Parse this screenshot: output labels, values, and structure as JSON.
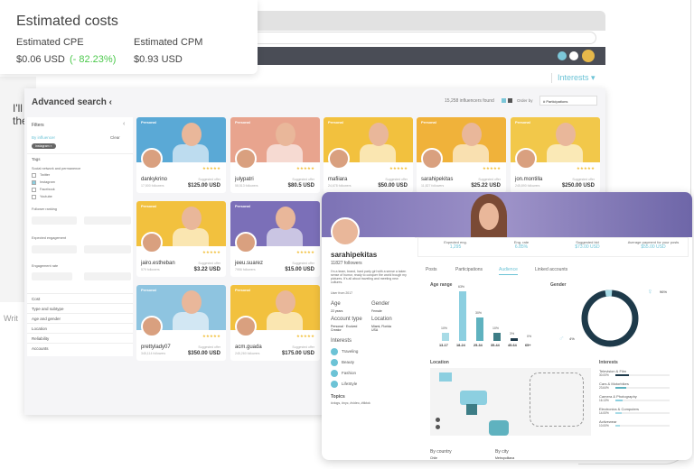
{
  "chat": {
    "lines": [
      "I'll",
      "the",
      "Writ"
    ]
  },
  "header": {
    "interests_label": "Interests ▾"
  },
  "estimated": {
    "title": "Estimated costs",
    "cpe_label": "Estimated CPE",
    "cpe_value": "$0.06 USD",
    "cpe_change": "(- 82.23%)",
    "cpm_label": "Estimated CPM",
    "cpm_value": "$0.93 USD",
    "change_color": "#4cc94c"
  },
  "search": {
    "title": "Advanced search ‹",
    "found": "15,258 influencers found",
    "order_label": "Order by",
    "order_value": "# Participations"
  },
  "filters": {
    "title": "Filters",
    "by_influencer": "By influencer",
    "clear": "Clear",
    "chip": "Instagram ×",
    "tags": "Tags",
    "social_label": "Social network and permanence",
    "networks": [
      {
        "label": "Twitter",
        "checked": false
      },
      {
        "label": "Instagram",
        "checked": true
      },
      {
        "label": "Facebook",
        "checked": false
      },
      {
        "label": "Youtube",
        "checked": false
      }
    ],
    "follower_ranking": "Follower ranking",
    "expected_engagement": "Expected engagement",
    "engagement_rate": "Engagement rate",
    "min": "Min",
    "max": "Max",
    "sections": [
      "Cost",
      "Type and subtype",
      "Age and gender",
      "Location",
      "Reliability",
      "Accounts"
    ]
  },
  "cards": [
    {
      "tag": "Personal",
      "name": "dankykrino",
      "followers": "17,500 followers",
      "offer_label": "Suggested offer",
      "price": "$125.00 USD",
      "color": "#5aa9d6"
    },
    {
      "tag": "Personal",
      "name": "julypatri",
      "followers": "58,513 followers",
      "offer_label": "Suggested offer",
      "price": "$80.5 USD",
      "color": "#e8a48e"
    },
    {
      "tag": "Personal",
      "name": "mafiiara",
      "followers": "24,678 followers",
      "offer_label": "Suggested offer",
      "price": "$50.00 USD",
      "color": "#f2c13e"
    },
    {
      "tag": "Personal",
      "name": "sarahipekitas",
      "followers": "11,827 followers",
      "offer_label": "Suggested offer",
      "price": "$25.22 USD",
      "color": "#f0b23a"
    },
    {
      "tag": "Personal",
      "name": "jon.montilla",
      "followers": "245,890 followers",
      "offer_label": "Suggested offer",
      "price": "$250.00 USD",
      "color": "#f2c84a"
    },
    {
      "tag": "Personal",
      "name": "jairo.estheban",
      "followers": "579 followers",
      "offer_label": "Suggested offer",
      "price": "$3.22 USD",
      "color": "#f2c13e"
    },
    {
      "tag": "Personal",
      "name": "jeeu.suarez",
      "followers": "7956 followers",
      "offer_label": "Suggested offer",
      "price": "$15.00 USD",
      "color": "#7b6fb8"
    },
    {
      "tag": "Personal",
      "name": "prettylady07",
      "followers": "345,114 followers",
      "offer_label": "Suggested offer",
      "price": "$350.00 USD",
      "color": "#8ec4e0"
    },
    {
      "tag": "Personal",
      "name": "acm.guada",
      "followers": "245,260 followers",
      "offer_label": "Suggested offer",
      "price": "$175.00 USD",
      "color": "#f2c13e"
    }
  ],
  "profile": {
    "name": "sarahipekitas",
    "followers": "11827 followers",
    "bio": "I'm a team, brand, hard party girl with a sense a taken sense of humor, ready to conquer the world trough my pictures. It's all about traveling and meeting new cultures.",
    "since": "User from 2017",
    "age_label": "Age",
    "age": "22 years",
    "gender_label": "Gender",
    "gender": "Female",
    "account_label": "Account type",
    "account": "Personal · Evolved Creator",
    "location_label": "Location",
    "location": "Miami, Florida USA",
    "interests_label": "Interests",
    "interests": [
      "Traveling",
      "Beauty",
      "Fashion",
      "LifeStyle"
    ],
    "topics_label": "Topics",
    "topics": "#vlogs, #nyc, #video, #tiktok",
    "stats": [
      {
        "label": "Expected eng.",
        "value": "1,295"
      },
      {
        "label": "Eng. rate",
        "value": "6.85%"
      },
      {
        "label": "Suggested bid",
        "value": "$73.00 USD"
      },
      {
        "label": "Average payment for your posts",
        "value": "$55.00 USD"
      }
    ],
    "tabs": [
      "Posts",
      "Participations",
      "Audience",
      "Linked accounts"
    ],
    "active_tab": "Audience",
    "location_title": "Location",
    "by_country": "By country",
    "country_first": "Chile",
    "by_city": "By city",
    "city_first": "Metropolitana",
    "accent": "#6cc3d6"
  },
  "chart_data": [
    {
      "type": "bar",
      "title": "Age range",
      "categories": [
        "13-17",
        "18-24",
        "25-34",
        "35-44",
        "45-64",
        "65+"
      ],
      "values": [
        10,
        63,
        30,
        10,
        3,
        0
      ],
      "labels": [
        "10%",
        "63%",
        "30%",
        "10%",
        "3%",
        "0%"
      ],
      "colors": [
        "#a8dbe6",
        "#8ccfe0",
        "#5fb2bf",
        "#3d7d86",
        "#1e3a4a",
        "#1e3a4a"
      ]
    },
    {
      "type": "pie",
      "title": "Gender",
      "categories": [
        "Female",
        "Male"
      ],
      "values": [
        96,
        4
      ],
      "labels": [
        "96%",
        "4%"
      ],
      "colors": [
        "#1e3a4a",
        "#a8dbe6"
      ]
    },
    {
      "type": "bar",
      "title": "Interests",
      "categories": [
        "Television & Film",
        "Cars & Motorbikes",
        "Camera & Photography",
        "Electronics & Computers",
        "Activewear"
      ],
      "values": [
        30.0,
        23.64,
        16.13,
        14.0,
        10.0
      ],
      "labels": [
        "30.00%",
        "23.64%",
        "16.13%",
        "14.00%",
        "10.00%"
      ],
      "colors": [
        "#1e3a4a",
        "#5fb2bf",
        "#8ccfe0",
        "#a8dbe6",
        "#a8dbe6"
      ]
    }
  ]
}
